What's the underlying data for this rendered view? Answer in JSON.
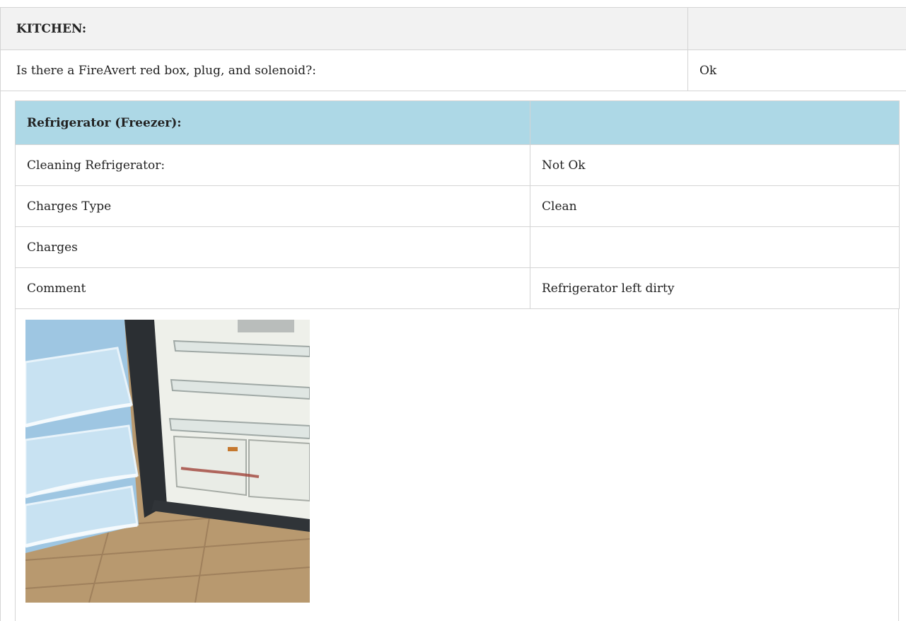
{
  "kitchen": {
    "title": "KITCHEN:",
    "rows": [
      {
        "label": "Is there a FireAvert red box, plug, and solenoid?:",
        "value": "Ok"
      }
    ]
  },
  "refrigerator": {
    "title": "Refrigerator (Freezer):",
    "rows": [
      {
        "label": "Cleaning Refrigerator:",
        "value": "Not Ok"
      },
      {
        "label": "Charges Type",
        "value": "Clean"
      },
      {
        "label": "Charges",
        "value": ""
      },
      {
        "label": "Comment",
        "value": "Refrigerator left dirty"
      }
    ],
    "photo_icon": "photo-of-open-refrigerator"
  }
}
